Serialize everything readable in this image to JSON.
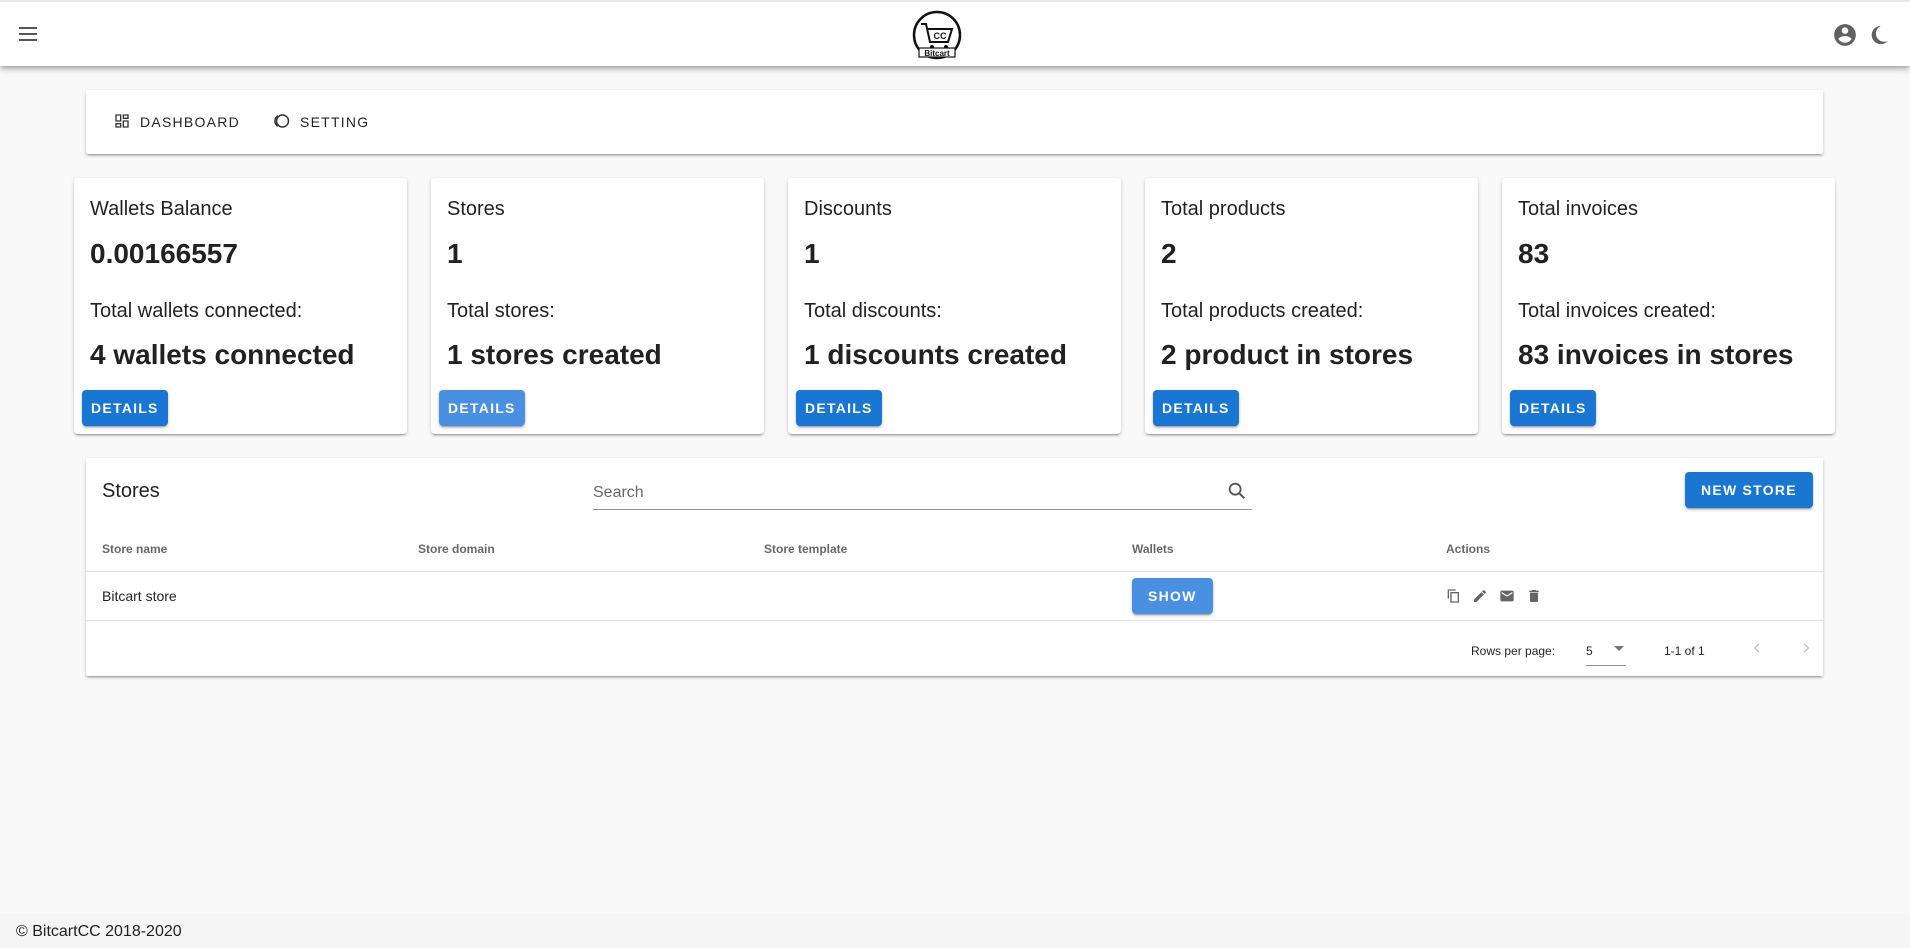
{
  "appbar": {
    "menu_icon": "menu-icon",
    "logo_text_top": "CC",
    "logo_text_bottom": "Bitcart",
    "account_icon": "account-circle-icon",
    "theme_icon": "moon-icon"
  },
  "nav": {
    "items": [
      {
        "label": "DASHBOARD",
        "icon": "dashboard-icon"
      },
      {
        "label": "SETTING",
        "icon": "toggle-icon"
      }
    ]
  },
  "cards": [
    {
      "title": "Wallets Balance",
      "value": "0.00166557",
      "sub_label": "Total wallets connected:",
      "sub_value": "4 wallets connected",
      "button": "DETAILS"
    },
    {
      "title": "Stores",
      "value": "1",
      "sub_label": "Total stores:",
      "sub_value": "1 stores created",
      "button": "DETAILS"
    },
    {
      "title": "Discounts",
      "value": "1",
      "sub_label": "Total discounts:",
      "sub_value": "1 discounts created",
      "button": "DETAILS"
    },
    {
      "title": "Total products",
      "value": "2",
      "sub_label": "Total products created:",
      "sub_value": "2 product in stores",
      "button": "DETAILS"
    },
    {
      "title": "Total invoices",
      "value": "83",
      "sub_label": "Total invoices created:",
      "sub_value": "83 invoices in stores",
      "button": "DETAILS"
    }
  ],
  "stores_table": {
    "title": "Stores",
    "search_placeholder": "Search",
    "search_value": "",
    "new_button": "NEW STORE",
    "columns": [
      "Store name",
      "Store domain",
      "Store template",
      "Wallets",
      "Actions"
    ],
    "rows": [
      {
        "name": "Bitcart store",
        "domain": "",
        "template": "",
        "wallets_button": "SHOW",
        "actions": [
          "copy-icon",
          "edit-icon",
          "email-icon",
          "delete-icon"
        ]
      }
    ],
    "rows_per_page_label": "Rows per page:",
    "rows_per_page": "5",
    "page_info": "1-1 of 1"
  },
  "footer": {
    "text": "© BitcartCC 2018-2020"
  },
  "colors": {
    "primary": "#1976d2",
    "primary_light": "#4a90e2",
    "background": "#f9f9f9"
  }
}
